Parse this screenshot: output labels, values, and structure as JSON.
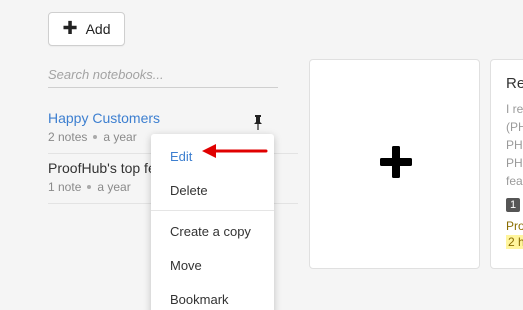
{
  "toolbar": {
    "add_label": "Add",
    "add_icon": "plus-icon"
  },
  "search": {
    "placeholder": "Search notebooks..."
  },
  "notebooks": [
    {
      "title": "Happy Customers",
      "notes": "2 notes",
      "age": "a year",
      "pinned": true,
      "color": "#3d7fd0"
    },
    {
      "title": "ProofHub's top fe",
      "notes": "1 note",
      "age": "a year",
      "pinned": false
    }
  ],
  "context_menu": {
    "items": [
      "Edit",
      "Delete",
      "Create a copy",
      "Move",
      "Bookmark"
    ],
    "active": "Edit",
    "annotation": {
      "type": "red-arrow",
      "color": "#e00000",
      "points_to": "Edit"
    }
  },
  "cards": {
    "new_note_icon": "plus-icon",
    "peek": {
      "title": "Re",
      "lines": [
        "I re",
        "(PH",
        "PH",
        "PH",
        "fea"
      ],
      "badge": "1",
      "author": "Pro",
      "highlight": "2 h"
    }
  },
  "colors": {
    "accent": "#3d7fd0",
    "arrow": "#e00000",
    "highlight": "#fff59d"
  }
}
